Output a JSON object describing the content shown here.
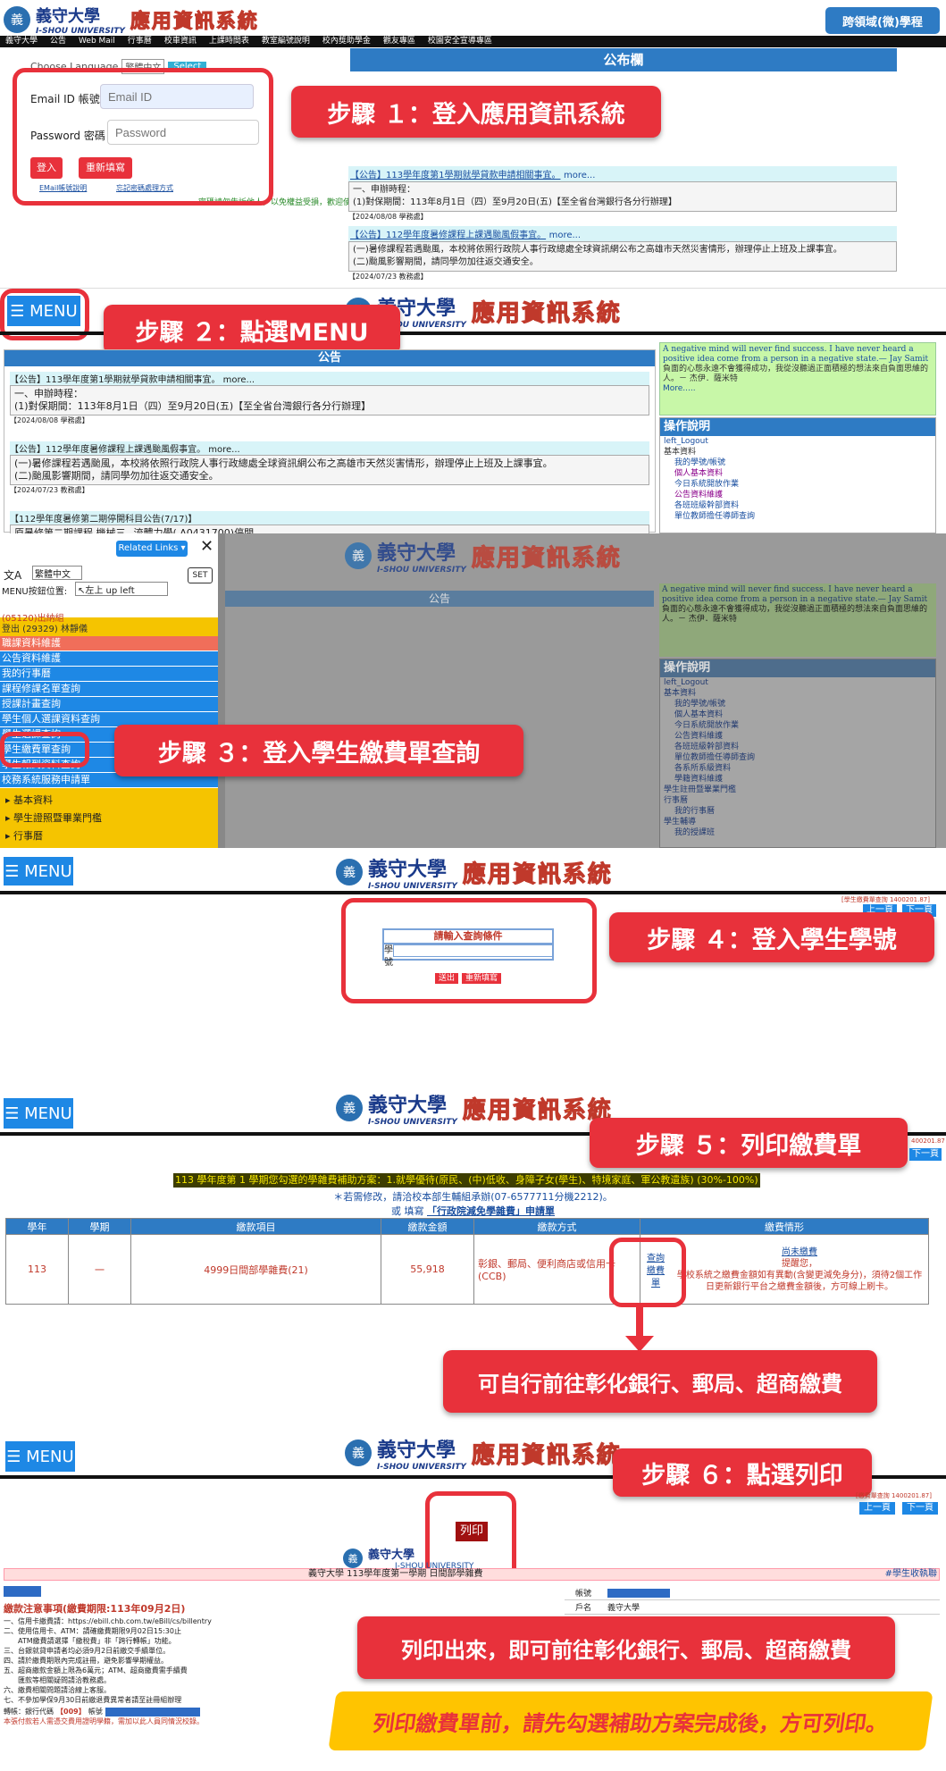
{
  "s1": {
    "school_ch": "義守大學",
    "school_en": "I-SHOU UNIVERSITY",
    "system_name": "應用資訊系統",
    "cross_button": "跨領域(微)學程",
    "nav": [
      "義守大學",
      "公告",
      "Web Mail",
      "行事曆",
      "校車資訊",
      "上課時間表",
      "教室編號說明",
      "校內獎助學金",
      "觀友專區",
      "校園安全宣導專區"
    ],
    "choose_language": "Choose Language",
    "lang_value": "繁體中文",
    "lang_button": "Select",
    "email_label": "Email ID 帳號：",
    "email_placeholder": "Email ID",
    "password_label": "Password 密碼：",
    "password_placeholder": "Password",
    "login_btn": "登入",
    "reset_btn": "重新填寫",
    "email_link": "EMail帳號說明",
    "forgot_link": "忘記密碼處理方式",
    "warn_text": "密碼請勿告訴他人，以免權益受損，歡迎使用資訊系統。",
    "board_title": "公布欄",
    "ann1_title": "【公告】113學年度第1學期就學貸款申請相關事宜。",
    "ann1_more": "more...",
    "ann1_l1": "一、申辦時程：",
    "ann1_l2": "(1)對保期間：113年8月1日（四）至9月20日(五)【至全省台灣銀行各分行辦理】",
    "ann1_date": "【2024/08/08 學務處】",
    "ann2_title": "【公告】112學年度暑修課程上課遇颱風假事宜。",
    "ann2_more": "more...",
    "ann2_l1": "(一)暑修課程若遇颱風，本校將依照行政院人事行政總處全球資訊網公布之高雄市天然災害情形，辦理停止上班及上課事宜。",
    "ann2_l2": "(二)颱風影響期間，請同學勿加往返交通安全。",
    "ann2_date": "【2024/07/23 教務處】"
  },
  "steps": {
    "s1": "步驟 １：登入應用資訊系統",
    "s2": "步驟 ２：點選MENU",
    "s3": "步驟 ３：登入學生繳費單查詢",
    "s4": "步驟 ４：登入學生學號",
    "s5": "步驟 ５：列印繳費單",
    "s6": "步驟 ６：點選列印",
    "pay1": "可自行前往彰化銀行、郵局、超商繳費",
    "pay2": "列印出來，即可前往彰化銀行、郵局、超商繳費",
    "note": "列印繳費單前，請先勾選補助方案完成後，方可列印。"
  },
  "menu_label": "☰ MENU",
  "s2": {
    "board_title": "公告",
    "ann1_title": "【公告】113學年度第1學期就學貸款申請相關事宜。",
    "ann1_more": "more...",
    "ann1_l1": "一、申辦時程：",
    "ann1_l2": "(1)對保期間：113年8月1日（四）至9月20日(五)【至全省台灣銀行各分行辦理】",
    "ann1_date": "【2024/08/08 學務處】",
    "ann2_title": "【公告】112學年度暑修課程上課遇颱風假事宜。",
    "ann2_more": "more...",
    "ann2_l1": "(一)暑修課程若遇颱風，本校將依照行政院人事行政總處全球資訊網公布之高雄市天然災害情形，辦理停止上班及上課事宜。",
    "ann2_l2": "(二)颱風影響期間，請同學勿加往返交通安全。",
    "ann2_date": "【2024/07/23 教務處】",
    "ann3_title": "【112學年度暑修第二期停開科目公告(7/17)】",
    "ann3_l1": "原暑修第二期課程 機械三_ 流體力學( A0431700)停開。",
    "quote_en": "A negative mind will never find success. I have never heard a positive idea come from a person in a negative state.— Jay Samit",
    "quote_ch": "負面的心態永遠不會獲得成功，我從沒聽過正面積極的想法來自負面思維的人。－ 杰伊．薩米特",
    "quote_more": "More.....",
    "ops_title": "操作說明",
    "ops_items": [
      "left_Logout",
      "基本資料",
      "我的學號/帳號",
      "個人基本資料",
      "今日系統開放作業",
      "公告資料維護",
      "各班班級幹部資料",
      "單位教師擔任導師查詢",
      "各系所系級資料",
      "學籍資料維護"
    ]
  },
  "s3": {
    "related_links": "Related Links",
    "lang_value": "繁體中文",
    "menu_pos_label": "MENU按鈕位置:",
    "menu_pos_value": "↖左上 up left",
    "set_btn": "SET",
    "user_line1": "(05120)出納組",
    "user_line2": "登出 (29329) 林靜儀",
    "items": [
      "職課資料維護",
      "公告資料維護",
      "我的行事曆",
      "課程修課名單查詢",
      "授課計畫查詢",
      "學生個人選課資料查詢",
      "學生選課查詢",
      "學生繳費單查詢",
      "學生報到資料查詢",
      "校務系統服務申請單"
    ],
    "groups": [
      "▸ 基本資料",
      "▸ 學生證照暨畢業門檻",
      "▸ 行事曆"
    ],
    "ops_extra": [
      "學生註冊暨畢業門檻",
      "行事曆",
      "我的行事曆",
      "學生輔導",
      "我的授課班"
    ]
  },
  "s4": {
    "top_right": "[學生繳費單查詢 1400201.87]",
    "prev_btn": "上一頁",
    "next_btn": "下一頁",
    "form_title": "請輸入查詢條件",
    "student_id_label": "學號",
    "submit_btn": "送出",
    "reset_btn": "重新填寫"
  },
  "s5": {
    "top_right": "400201.87",
    "next_btn": "下一頁",
    "plan_line": "113 學年度第 1 學期您勾選的學雜費補助方案：1.就學優待(原民、(中)低收、身障子女(學生)、特境家庭、軍公教遺族) (30%-100%)",
    "contact_line": "＊若需修改，請洽校本部生輔組承辦(07-6577711分機2212)。",
    "link_pre": "或 填寫",
    "link_text": "「行政院減免學雜費」申請單",
    "headers": [
      "學年",
      "學期",
      "繳款項目",
      "繳款金額",
      "繳款方式",
      "繳費情形"
    ],
    "row": {
      "year": "113",
      "term": "一",
      "item": "4999日間部學雜費(21)",
      "amount": "55,918",
      "method": "彰銀、郵局、便利商店或信用卡(CCB)",
      "query": "查詢繳費單",
      "status1": "尚未繳費",
      "status2": "提醒您，",
      "status3": "學校系統之繳費金額如有異動(含變更減免身分)，須待2個工作日更新銀行平台之繳費金額後，方可線上刷卡。"
    }
  },
  "s6": {
    "top_right": "[繳費單查詢 1400201.87]",
    "prev_btn": "上一頁",
    "next_btn": "下一頁",
    "print_btn": "列印",
    "school_ch": "義守大學",
    "school_en": "I-SHOU UNIVERSITY",
    "bill_title": "義守大學 113學年度第一學期 日間部學雜費",
    "bill_right": "#學生收執聯",
    "notice_title": "繳款注意事項(繳費期限:113年09月2日)",
    "notice_lines": [
      "一、信用卡繳費請：https://ebill.chb.com.tw/eBill/cs/billentry",
      "二、使用信用卡、ATM：請確繳費期限9月02日15:30止",
      "　　ATM繳費請選擇「繳稅費」非「跨行轉帳」功能。",
      "三、台銀就貸申請者均必須9月2日前繳交手續單位。",
      "四、請於繳費期限內完成註冊，避免影響學期權益。",
      "五、超商繳款金額上限為6萬元；ATM、超商繳費需手續費",
      "　　匯款等相關疑問請洽教務處。",
      "六、繳費相關問題請洽線上客服。",
      "七、不參加學保9月30日前繳退費異常者請至註冊組辦理"
    ],
    "bank_line_pre": "轉帳：銀行代碼",
    "bank_code": "【009】",
    "bank_label": "帳號",
    "footer_red": "本張付款若人需憑交費用證明學籍，需加以此人員同情況校錄。",
    "form_rows": [
      "帳號",
      "戶名"
    ],
    "account_name": "義守大學"
  }
}
